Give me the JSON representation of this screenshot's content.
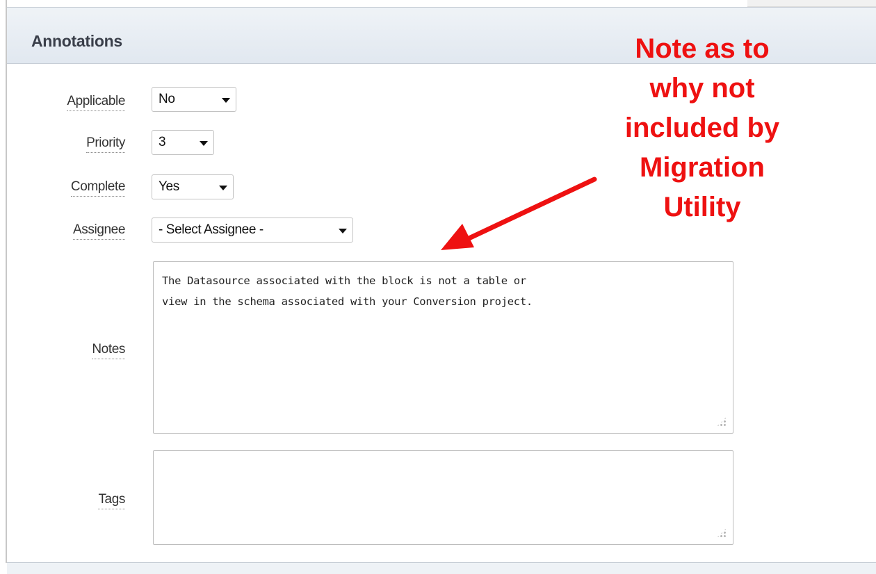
{
  "region": {
    "title": "Annotations"
  },
  "fields": {
    "applicable": {
      "label": "Applicable",
      "value": "No"
    },
    "priority": {
      "label": "Priority",
      "value": "3"
    },
    "complete": {
      "label": "Complete",
      "value": "Yes"
    },
    "assignee": {
      "label": "Assignee",
      "value": "- Select Assignee -"
    },
    "notes": {
      "label": "Notes",
      "value": "The Datasource associated with the block is not a table or\nview in the schema associated with your Conversion project."
    },
    "tags": {
      "label": "Tags",
      "value": ""
    }
  },
  "callout": {
    "text": "Note as to\nwhy not\nincluded by\nMigration\nUtility",
    "color": "#ee1111"
  },
  "icons": [
    "caret-down-icon",
    "resize-grip-icon",
    "callout-arrow-icon"
  ]
}
